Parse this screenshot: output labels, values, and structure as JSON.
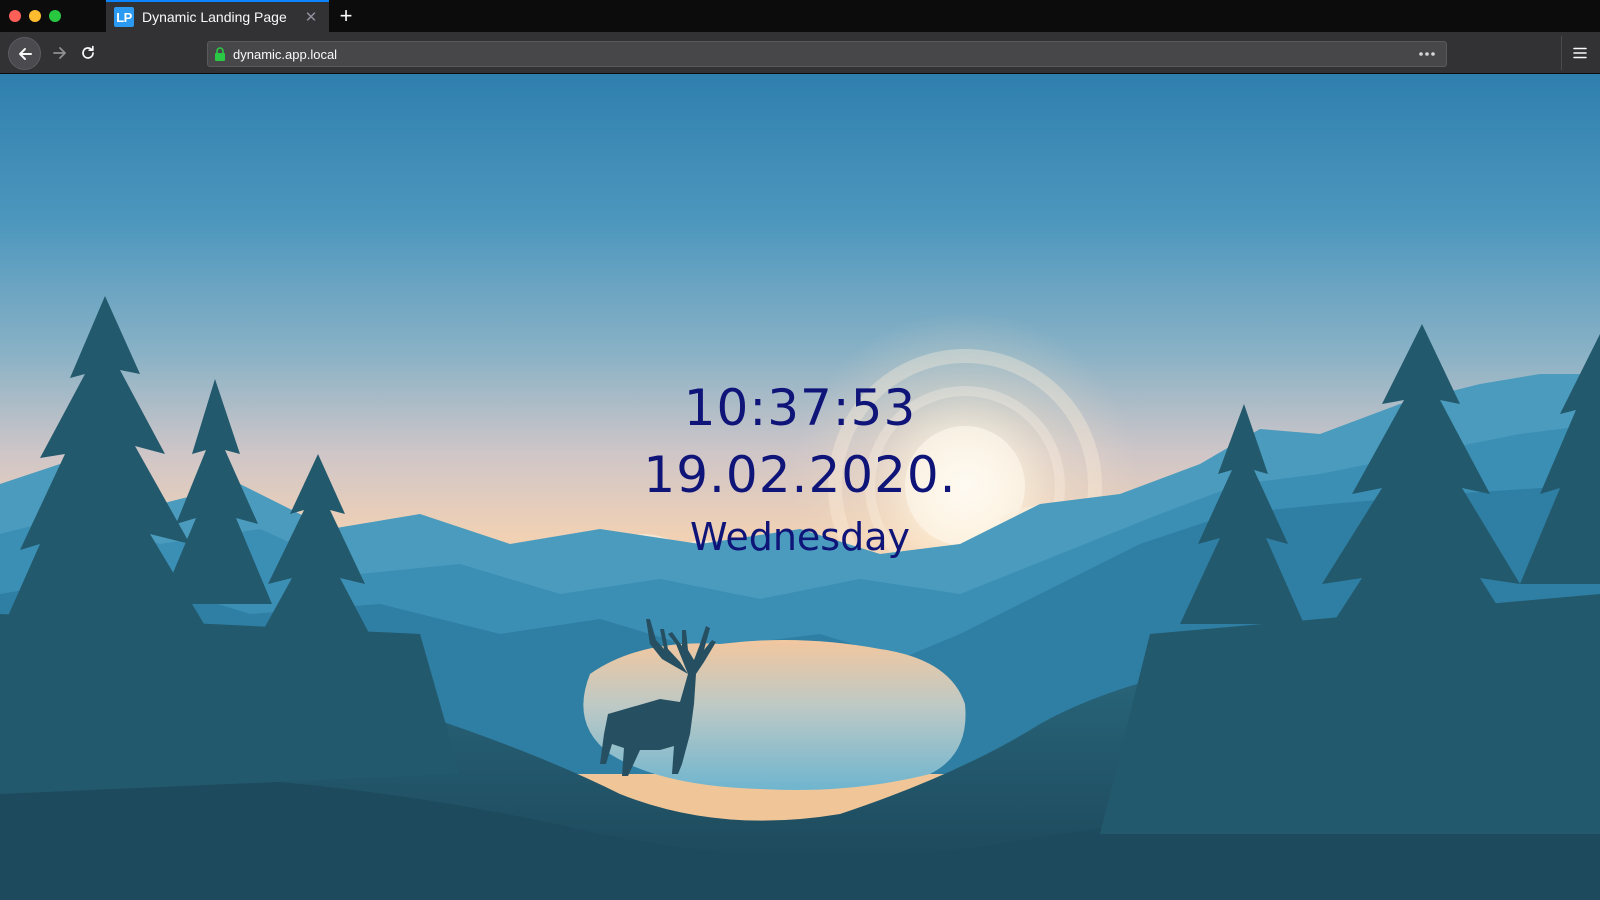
{
  "browser": {
    "tab": {
      "favicon_text": "LP",
      "title": "Dynamic Landing Page",
      "close_glyph": "✕",
      "accent_color": "#0a84ff"
    },
    "new_tab_glyph": "+",
    "address": {
      "url": "dynamic.app.local",
      "secure_icon": "lock-icon",
      "lock_color": "#2ac845"
    },
    "icons": {
      "back": "back-arrow-icon",
      "forward": "forward-arrow-icon",
      "reload": "reload-icon",
      "page_actions": "more-horizontal-icon",
      "menu": "hamburger-menu-icon"
    }
  },
  "page": {
    "time": "10:37:53",
    "date": "19.02.2020.",
    "weekday": "Wednesday",
    "text_color": "#0f1478",
    "background": "mountain-lake-deer-landscape"
  }
}
